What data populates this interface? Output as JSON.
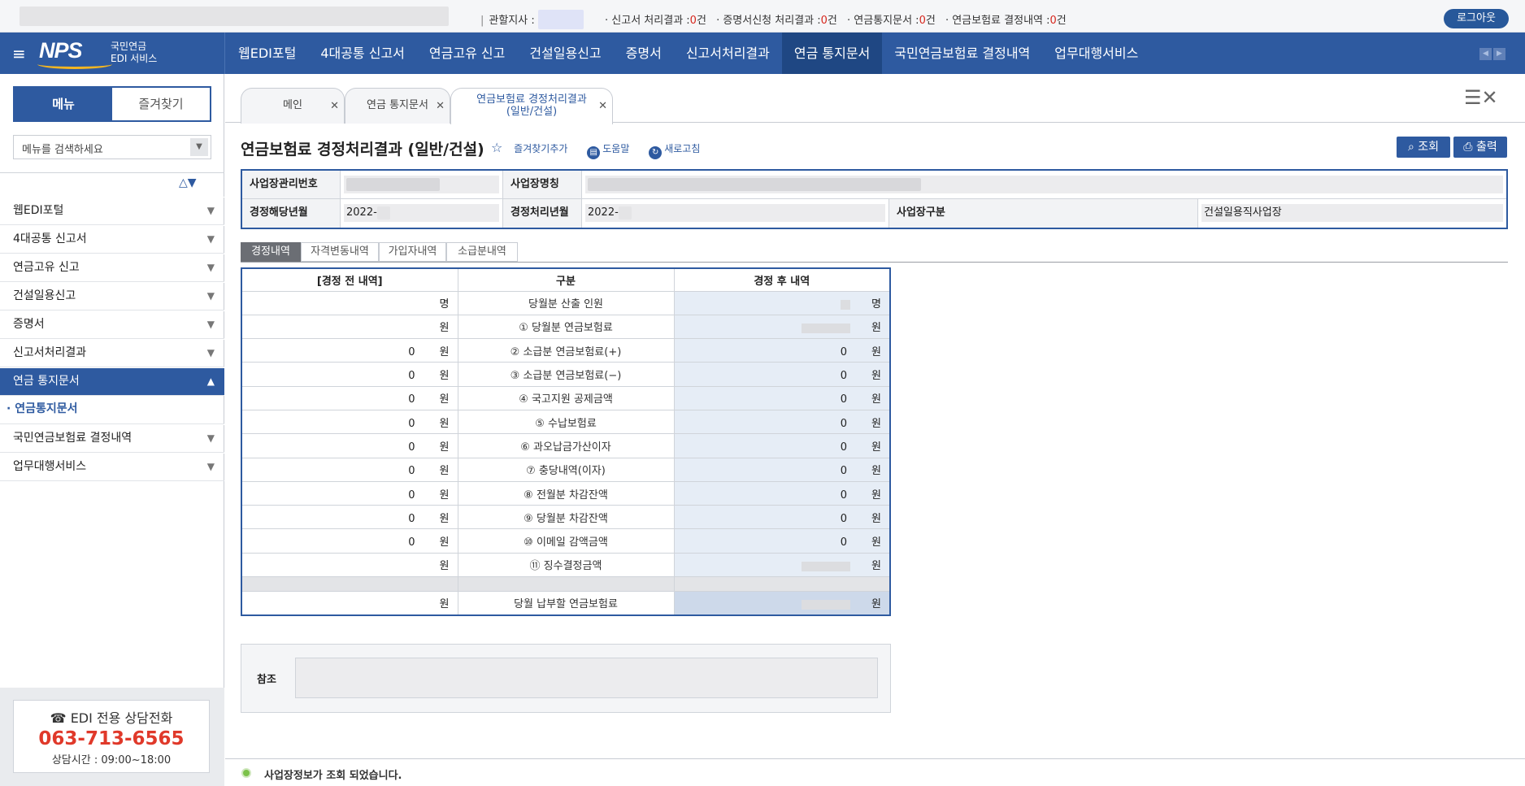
{
  "topbar": {
    "branch_label": "관할지사 :",
    "items": [
      {
        "label": "신고서 처리결과 :",
        "count": "0",
        "unit": "건"
      },
      {
        "label": "증명서신청 처리결과 :",
        "count": "0",
        "unit": "건"
      },
      {
        "label": "연금통지문서 :",
        "count": "0",
        "unit": "건"
      },
      {
        "label": "연금보험료 결정내역 :",
        "count": "0",
        "unit": "건"
      }
    ],
    "logout": "로그아웃"
  },
  "logo": {
    "brand": "NPS",
    "line1": "국민연금",
    "line2": "EDI 서비스"
  },
  "gnb": [
    "웹EDI포털",
    "4대공통 신고서",
    "연금고유 신고",
    "건설일용신고",
    "증명서",
    "신고서처리결과",
    "연금 통지문서",
    "국민연금보험료 결정내역",
    "업무대행서비스"
  ],
  "sidebar": {
    "tab_menu": "메뉴",
    "tab_fav": "즐겨찾기",
    "search_placeholder": "메뉴를 검색하세요",
    "items": [
      "웹EDI포털",
      "4대공통 신고서",
      "연금고유 신고",
      "건설일용신고",
      "증명서",
      "신고서처리결과",
      "연금 통지문서"
    ],
    "active_sub": "연금통지문서",
    "items_after": [
      "국민연금보험료 결정내역",
      "업무대행서비스"
    ],
    "call_title": "☎ EDI 전용 상담전화",
    "call_number": "063-713-6565",
    "call_hours": "상담시간 : 09:00~18:00"
  },
  "tabs": [
    {
      "label": "메인"
    },
    {
      "label": "연금 통지문서"
    },
    {
      "label_line1": "연금보험료 경정처리결과",
      "label_line2": "(일반/건설)"
    }
  ],
  "page": {
    "title": "연금보험료 경정처리결과 (일반/건설)",
    "fav_link": "즐겨찾기추가",
    "help_link": "도움말",
    "refresh_link": "새로고침",
    "btn_search": "조회",
    "btn_print": "출력"
  },
  "info": {
    "biz_no_label": "사업장관리번호",
    "biz_name_label": "사업장명칭",
    "month_label": "경정해당년월",
    "month_value": "2022-",
    "proc_label": "경정처리년월",
    "proc_value": "2022-",
    "type_label": "사업장구분",
    "type_value": "건설일용직사업장"
  },
  "subtabs": [
    "경정내역",
    "자격변동내역",
    "가입자내역",
    "소급분내역"
  ],
  "grid": {
    "headers": [
      "[경정 전 내역]",
      "구분",
      "경정 후 내역"
    ],
    "rows": [
      {
        "before": "",
        "before_unit": "명",
        "label": "당월분 산출 인원",
        "after": "",
        "after_unit": "명"
      },
      {
        "before": "",
        "before_unit": "원",
        "label": "① 당월분 연금보험료",
        "after": "",
        "after_unit": "원"
      },
      {
        "before": "0",
        "before_unit": "원",
        "label": "② 소급분 연금보험료(+)",
        "after": "0",
        "after_unit": "원"
      },
      {
        "before": "0",
        "before_unit": "원",
        "label": "③ 소급분 연금보험료(−)",
        "after": "0",
        "after_unit": "원"
      },
      {
        "before": "0",
        "before_unit": "원",
        "label": "④ 국고지원 공제금액",
        "after": "0",
        "after_unit": "원"
      },
      {
        "before": "0",
        "before_unit": "원",
        "label": "⑤ 수납보험료",
        "after": "0",
        "after_unit": "원"
      },
      {
        "before": "0",
        "before_unit": "원",
        "label": "⑥ 과오납금가산이자",
        "after": "0",
        "after_unit": "원"
      },
      {
        "before": "0",
        "before_unit": "원",
        "label": "⑦ 충당내역(이자)",
        "after": "0",
        "after_unit": "원"
      },
      {
        "before": "0",
        "before_unit": "원",
        "label": "⑧ 전월분 차감잔액",
        "after": "0",
        "after_unit": "원"
      },
      {
        "before": "0",
        "before_unit": "원",
        "label": "⑨ 당월분 차감잔액",
        "after": "0",
        "after_unit": "원"
      },
      {
        "before": "0",
        "before_unit": "원",
        "label": "⑩ 이메일 감액금액",
        "after": "0",
        "after_unit": "원"
      },
      {
        "before": "",
        "before_unit": "원",
        "label": "⑪ 징수결정금액",
        "after": "",
        "after_unit": "원"
      }
    ],
    "total": {
      "before": "",
      "before_unit": "원",
      "label": "당월 납부할 연금보험료",
      "after": "",
      "after_unit": "원"
    }
  },
  "ref": {
    "label": "참조"
  },
  "status": {
    "message": "사업장정보가 조회 되었습니다."
  }
}
